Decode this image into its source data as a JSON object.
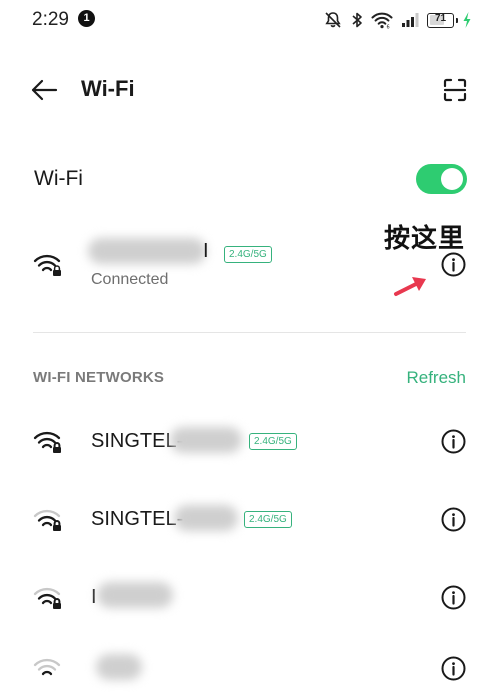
{
  "status_bar": {
    "time": "2:29",
    "notification_count": "1",
    "battery_percent": "71",
    "icons": [
      "mute-icon",
      "bluetooth-icon",
      "wifi-status-icon",
      "signal-icon",
      "battery-icon",
      "charging-icon"
    ]
  },
  "header": {
    "title": "Wi-Fi",
    "back_icon": "arrow-left-icon",
    "scan_icon": "qr-scan-icon"
  },
  "wifi_toggle": {
    "label": "Wi-Fi",
    "enabled": true,
    "accent_color": "#2ecc71"
  },
  "annotation": {
    "text": "按这里",
    "arrow_color": "#e8384f"
  },
  "connected_network": {
    "name_visible": "I",
    "band": "2.4G/5G",
    "status": "Connected"
  },
  "networks_section": {
    "title": "WI-FI NETWORKS",
    "refresh_label": "Refresh"
  },
  "networks": [
    {
      "name": "SINGTEL-",
      "band": "2.4G/5G"
    },
    {
      "name": "SINGTEL-",
      "band": "2.4G/5G"
    },
    {
      "name": "I",
      "band": ""
    },
    {
      "name": "",
      "band": ""
    }
  ],
  "colors": {
    "accent": "#36b27d",
    "toggle_on": "#2ecc71",
    "text_primary": "#1a1a1a",
    "text_secondary": "#6e6e6e",
    "section_header": "#7a7a7a"
  }
}
